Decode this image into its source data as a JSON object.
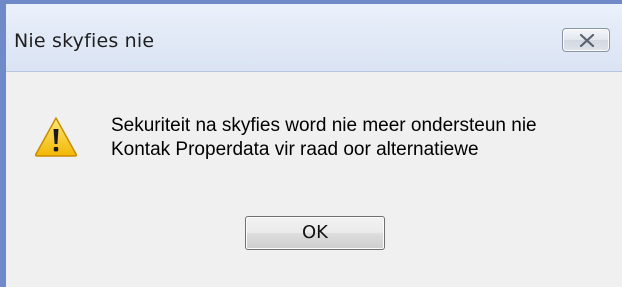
{
  "dialog": {
    "title": "Nie skyfies nie",
    "message_line1": "Sekuriteit na skyfies word nie meer ondersteun nie",
    "message_line2": "Kontak Properdata vir raad oor alternatiewe",
    "ok_label": "OK",
    "icon": "warning-icon",
    "close_icon": "close-icon"
  },
  "colors": {
    "window_border": "#6f89c9",
    "titlebar": "#e2eaf7",
    "client_background": "#f0f0f0",
    "warning_yellow": "#f5c400"
  }
}
